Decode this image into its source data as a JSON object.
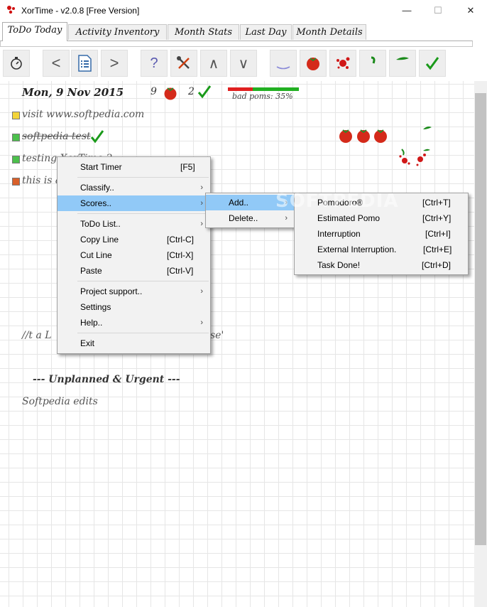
{
  "window": {
    "title": "XorTime - v2.0.8 [Free Version]",
    "minimize": "—",
    "maximize": "☐",
    "close": "✕"
  },
  "tabs": [
    {
      "label": "ToDo Today",
      "active": true
    },
    {
      "label": "Activity Inventory"
    },
    {
      "label": "Month Stats"
    },
    {
      "label": "Last Day"
    },
    {
      "label": "Month Details"
    }
  ],
  "toolbar": {
    "buttons": [
      "timer-icon",
      "back-arrow-icon",
      "document-list-icon",
      "forward-arrow-icon",
      "help-icon",
      "tools-icon",
      "move-up-icon",
      "move-down-icon",
      "underline-icon",
      "tomato-icon",
      "splat-icon",
      "leaf-small-icon",
      "leaf-icon",
      "checkmark-icon"
    ],
    "help_glyph": "?",
    "up_glyph": "∧",
    "down_glyph": "∨",
    "back_glyph": "<",
    "forward_glyph": ">"
  },
  "summary": {
    "date": "Mon, 9 Nov 2015",
    "pomodoro_count": "9",
    "done_count": "2",
    "bad_poms_label": "bad poms: 35%",
    "bad_poms_fraction": 0.35,
    "colors": {
      "bad": "#e02020",
      "good": "#22b022",
      "check": "#1a9a1a",
      "tomato": "#d42a1a"
    }
  },
  "tasks": [
    {
      "text": "visit www.softpedia.com",
      "color": "#f3d43a",
      "struck": false
    },
    {
      "text": "softpedia test",
      "color": "#4cc04c",
      "struck": true
    },
    {
      "text": "testing XorTime 2",
      "color": "#4cc04c",
      "struck": false
    },
    {
      "text": "this is a task",
      "color": "#d9602a",
      "struck": false
    }
  ],
  "note_line": "//t a L",
  "note_tail": "se'",
  "unplanned_header": "--- Unplanned & Urgent ---",
  "unplanned_items": [
    "Softpedia edits"
  ],
  "context_menu": {
    "items": [
      {
        "label": "Start Timer",
        "shortcut": "[F5]"
      },
      {
        "sep": true
      },
      {
        "label": "Classify..",
        "submenu": true
      },
      {
        "label": "Scores..",
        "submenu": true,
        "highlight": true
      },
      {
        "sep": true
      },
      {
        "label": "ToDo List..",
        "submenu": true
      },
      {
        "label": "Copy Line",
        "shortcut": "[Ctrl-C]"
      },
      {
        "label": "Cut Line",
        "shortcut": "[Ctrl-X]"
      },
      {
        "label": "Paste",
        "shortcut": "[Ctrl-V]"
      },
      {
        "sep": true
      },
      {
        "label": "Project support..",
        "submenu": true
      },
      {
        "label": "Settings"
      },
      {
        "label": "Help..",
        "submenu": true
      },
      {
        "sep": true
      },
      {
        "label": "Exit"
      }
    ],
    "arrow": "›"
  },
  "scores_menu": {
    "add": "Add..",
    "delete": "Delete.."
  },
  "add_menu": {
    "items": [
      {
        "label": "Pomodoro®",
        "shortcut": "[Ctrl+T]"
      },
      {
        "label": "Estimated Pomo",
        "shortcut": "[Ctrl+Y]"
      },
      {
        "label": "Interruption",
        "shortcut": "[Ctrl+I]"
      },
      {
        "label": "External Interruption.",
        "shortcut": "[Ctrl+E]"
      },
      {
        "label": "Task Done!",
        "shortcut": "[Ctrl+D]"
      }
    ]
  },
  "watermark": "SOFTPEDIA"
}
